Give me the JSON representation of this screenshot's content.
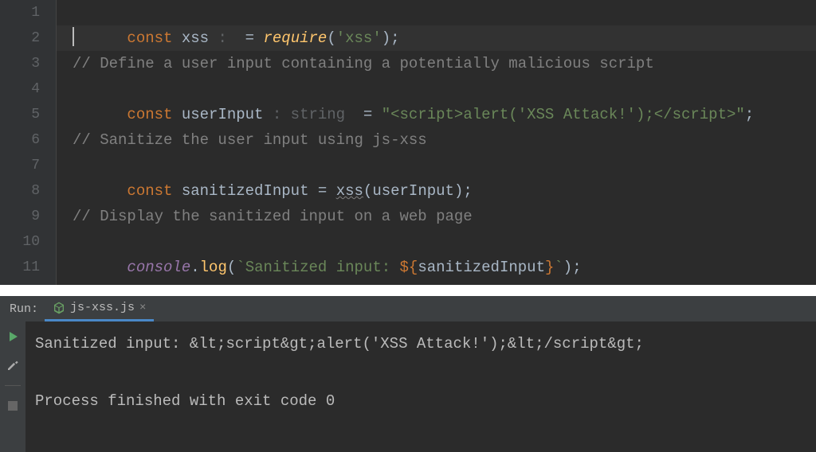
{
  "editor": {
    "line_numbers": [
      "1",
      "2",
      "3",
      "4",
      "5",
      "6",
      "7",
      "8",
      "9",
      "10",
      "11"
    ],
    "lines": {
      "l1": {
        "kw1": "const",
        "var": "xss",
        "hint": " :  ",
        "op": "= ",
        "fn": "require",
        "paren_open": "(",
        "str": "'xss'",
        "paren_close": ")",
        "semi": ";"
      },
      "l3": "// Define a user input containing a potentially malicious script",
      "l4": {
        "kw1": "const",
        "var": "userInput",
        "hint": " : string  ",
        "op": "= ",
        "str": "\"<script>alert('XSS Attack!');</script>\"",
        "semi": ";"
      },
      "l6": "// Sanitize the user input using js-xss",
      "l7": {
        "kw1": "const",
        "var": "sanitizedInput",
        "op": " = ",
        "fn": "xss",
        "paren_open": "(",
        "arg": "userInput",
        "paren_close": ")",
        "semi": ";"
      },
      "l9": "// Display the sanitized input on a web page",
      "l10": {
        "obj": "console",
        "dot": ".",
        "method": "log",
        "paren_open": "(",
        "tick1": "`",
        "tmpl_text": "Sanitized input: ",
        "tmpl_open": "${",
        "tmpl_var": "sanitizedInput",
        "tmpl_close": "}",
        "tick2": "`",
        "paren_close": ")",
        "semi": ";"
      }
    }
  },
  "run": {
    "label": "Run:",
    "tab_name": "js-xss.js",
    "tab_close": "×",
    "output_line1": "Sanitized input: &lt;script&gt;alert('XSS Attack!');&lt;/script&gt;",
    "output_line2": "Process finished with exit code 0"
  },
  "icons": {
    "node_color": "#689f63",
    "play_color": "#59a869",
    "wrench_color": "#aaaaaa",
    "stop_color": "#666666"
  }
}
